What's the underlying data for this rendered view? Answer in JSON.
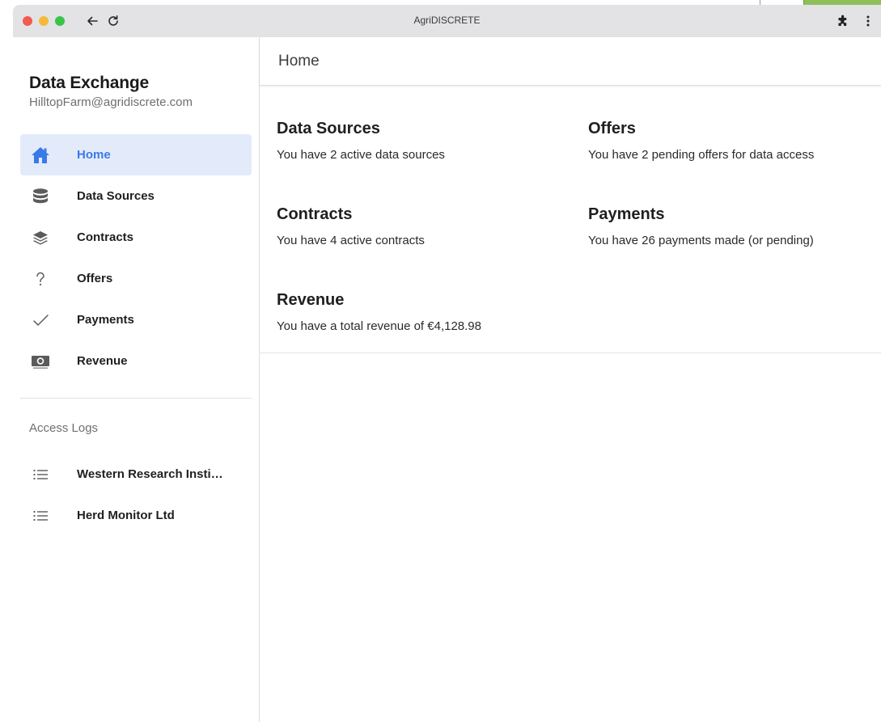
{
  "window": {
    "title": "AgriDISCRETE"
  },
  "sidebar": {
    "app_title": "Data Exchange",
    "user_email": "HilltopFarm@agridiscrete.com",
    "nav": [
      {
        "label": "Home",
        "icon": "home-icon",
        "active": true
      },
      {
        "label": "Data Sources",
        "icon": "database-icon"
      },
      {
        "label": "Contracts",
        "icon": "layers-icon"
      },
      {
        "label": "Offers",
        "icon": "question-icon"
      },
      {
        "label": "Payments",
        "icon": "check-icon"
      },
      {
        "label": "Revenue",
        "icon": "money-icon"
      }
    ],
    "access_logs_label": "Access Logs",
    "access_logs": [
      {
        "label": "Western Research Insti…",
        "icon": "list-icon"
      },
      {
        "label": "Herd Monitor Ltd",
        "icon": "list-icon"
      }
    ]
  },
  "header": {
    "title": "Home"
  },
  "cards": [
    {
      "title": "Data Sources",
      "text": "You have 2 active data sources"
    },
    {
      "title": "Offers",
      "text": "You have 2 pending offers for data access"
    },
    {
      "title": "Contracts",
      "text": "You have 4 active contracts"
    },
    {
      "title": "Payments",
      "text": "You have 26 payments made (or pending)"
    },
    {
      "title": "Revenue",
      "text": "You have a total revenue of €4,128.98"
    }
  ],
  "colors": {
    "accent": "#3a7ae6",
    "active_bg": "#e3ebfb",
    "titlebar": "#e3e3e5",
    "close": "#f45952",
    "minimize": "#f6b93a",
    "maximize": "#38c34a"
  }
}
